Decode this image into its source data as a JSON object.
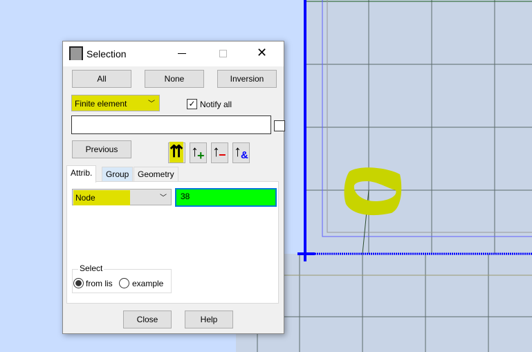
{
  "dialog": {
    "title": "Selection",
    "buttons": {
      "all": "All",
      "none": "None",
      "inversion": "Inversion",
      "previous": "Previous",
      "close": "Close",
      "help": "Help"
    },
    "entity_type": "Finite element",
    "notify_all": {
      "label": "Notify all",
      "checked": true
    },
    "selection_input": "",
    "tools": [
      "select-replace-icon",
      "select-add-icon",
      "select-remove-icon",
      "select-intersect-icon"
    ],
    "tabs": [
      {
        "label": "Attrib.",
        "active": true
      },
      {
        "label": "Group"
      },
      {
        "label": "Geometry"
      }
    ],
    "attribute": "Node",
    "value": "38",
    "select_group": {
      "title": "Select",
      "options": [
        {
          "label": "from lis",
          "checked": true
        },
        {
          "label": "example",
          "checked": false
        }
      ]
    }
  },
  "colors": {
    "highlight": "#e0e000",
    "value_bg": "#00ff00",
    "axis": "#0000ff"
  }
}
